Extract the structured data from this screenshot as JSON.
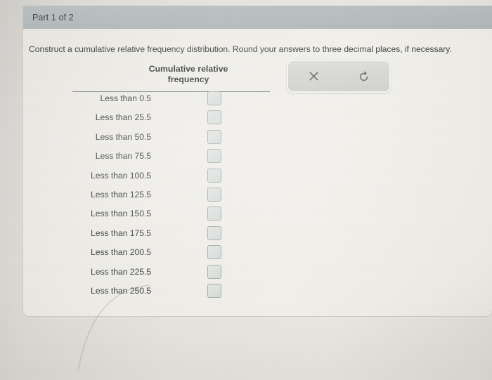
{
  "part_header": {
    "label": "Part 1 of 2"
  },
  "instruction": {
    "text": "Construct a cumulative relative frequency distribution. Round your answers to three decimal places, if necessary."
  },
  "table": {
    "column_header": {
      "line1": "Cumulative relative",
      "line2": "frequency"
    },
    "rows": [
      {
        "label": "Less than 0.5",
        "value": "",
        "placeholder": ""
      },
      {
        "label": "Less than 25.5",
        "value": "",
        "placeholder": ""
      },
      {
        "label": "Less than 50.5",
        "value": "",
        "placeholder": ""
      },
      {
        "label": "Less than 75.5",
        "value": "",
        "placeholder": ""
      },
      {
        "label": "Less than 100.5",
        "value": "",
        "placeholder": ""
      },
      {
        "label": "Less than 125.5",
        "value": "",
        "placeholder": ""
      },
      {
        "label": "Less than 150.5",
        "value": "",
        "placeholder": ""
      },
      {
        "label": "Less than 175.5",
        "value": "",
        "placeholder": ""
      },
      {
        "label": "Less than 200.5",
        "value": "",
        "placeholder": ""
      },
      {
        "label": "Less than 225.5",
        "value": "",
        "placeholder": ""
      },
      {
        "label": "Less than 250.5",
        "value": "",
        "placeholder": ""
      }
    ]
  },
  "toolbar": {
    "buttons": [
      {
        "icon": "close-x-icon",
        "label": "×"
      },
      {
        "icon": "undo-arrow-icon",
        "label": "↺"
      }
    ]
  },
  "colors": {
    "header_bar": "#adb4b4",
    "card_background": "#ece9e3",
    "page_background": "#d9d7d1",
    "text": "#24262a",
    "rule": "#6f7173",
    "input_border": "#9aa3a2",
    "input_fill": "#d7dcd9",
    "toolbar_fill": "#cfcfcc"
  }
}
